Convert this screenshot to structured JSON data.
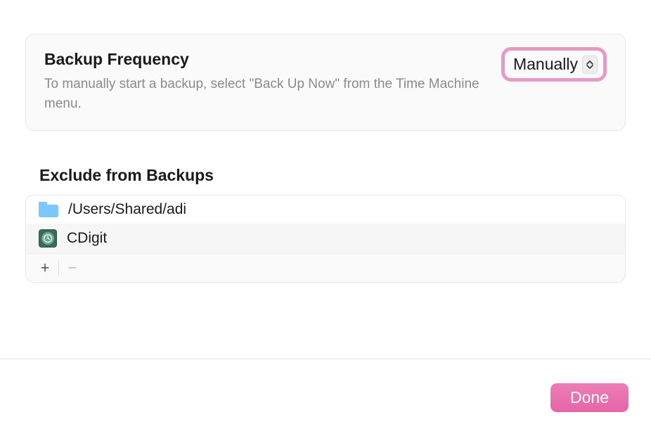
{
  "frequency": {
    "title": "Backup Frequency",
    "subtitle": "To manually start a backup, select \"Back Up Now\" from the Time Machine menu.",
    "dropdown_value": "Manually"
  },
  "exclude": {
    "title": "Exclude from Backups",
    "items": [
      {
        "icon": "folder",
        "path": "/Users/Shared/adi"
      },
      {
        "icon": "timemachine",
        "path": "CDigit"
      }
    ],
    "add_label": "+",
    "remove_label": "−"
  },
  "footer": {
    "done_label": "Done"
  }
}
